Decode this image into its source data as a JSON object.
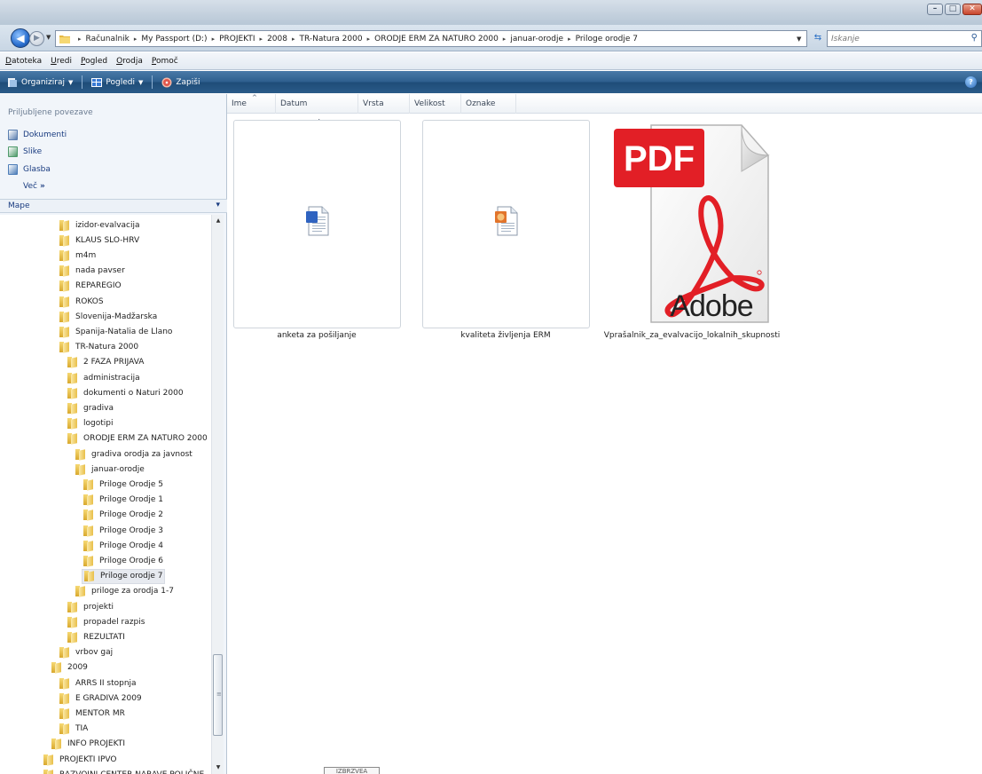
{
  "window": {
    "min_glyph": "–",
    "max_glyph": "□",
    "close_glyph": "✕"
  },
  "address": {
    "back_glyph": "◀",
    "fwd_glyph": "▶",
    "crumbs": [
      "Računalnik",
      "My Passport (D:)",
      "PROJEKTI",
      "2008",
      "TR-Natura 2000",
      "ORODJE ERM ZA NATURO 2000",
      "januar-orodje",
      "Priloge orodje 7"
    ],
    "separator": "▸",
    "search_placeholder": "Iskanje"
  },
  "menubar": [
    "Datoteka",
    "Uredi",
    "Pogled",
    "Orodja",
    "Pomoč"
  ],
  "commandbar": {
    "organize": "Organiziraj",
    "views": "Pogledi",
    "burn": "Zapiši",
    "help_glyph": "?"
  },
  "favorites": {
    "header": "Priljubljene povezave",
    "items": [
      {
        "label": "Dokumenti",
        "color": "#5b7fb0"
      },
      {
        "label": "Slike",
        "color": "#4f9a6b"
      },
      {
        "label": "Glasba",
        "color": "#4d7db8"
      }
    ],
    "more_label": "Več",
    "more_glyph": "»"
  },
  "folders_header": "Mape",
  "tree": [
    {
      "label": "izidor-evalvacija",
      "level": 3
    },
    {
      "label": "KLAUS SLO-HRV",
      "level": 3
    },
    {
      "label": "m4m",
      "level": 3
    },
    {
      "label": "nada pavser",
      "level": 3
    },
    {
      "label": "REPAREGIO",
      "level": 3
    },
    {
      "label": "ROKOS",
      "level": 3
    },
    {
      "label": "Slovenija-Madžarska",
      "level": 3
    },
    {
      "label": "Spanija-Natalia de Llano",
      "level": 3
    },
    {
      "label": "TR-Natura 2000",
      "level": 3
    },
    {
      "label": "2 FAZA PRIJAVA",
      "level": 4
    },
    {
      "label": "administracija",
      "level": 4
    },
    {
      "label": "dokumenti o Naturi 2000",
      "level": 4
    },
    {
      "label": "gradiva",
      "level": 4
    },
    {
      "label": "logotipi",
      "level": 4
    },
    {
      "label": "ORODJE ERM ZA NATURO 2000",
      "level": 4
    },
    {
      "label": "gradiva orodja za javnost",
      "level": 5
    },
    {
      "label": "januar-orodje",
      "level": 5
    },
    {
      "label": "Priloge  Orodje 5",
      "level": 6
    },
    {
      "label": "Priloge Orodje 1",
      "level": 6
    },
    {
      "label": "Priloge Orodje 2",
      "level": 6
    },
    {
      "label": "Priloge Orodje 3",
      "level": 6
    },
    {
      "label": "Priloge Orodje 4",
      "level": 6
    },
    {
      "label": "Priloge Orodje 6",
      "level": 6
    },
    {
      "label": "Priloge orodje 7",
      "level": 6,
      "selected": true
    },
    {
      "label": "priloge za orodja 1-7",
      "level": 5
    },
    {
      "label": "projekti",
      "level": 4
    },
    {
      "label": "propadel razpis",
      "level": 4
    },
    {
      "label": "REZULTATI",
      "level": 4
    },
    {
      "label": "vrbov gaj",
      "level": 3
    },
    {
      "label": "2009",
      "level": 2
    },
    {
      "label": "ARRS II stopnja",
      "level": 3
    },
    {
      "label": "E GRADIVA 2009",
      "level": 3
    },
    {
      "label": "MENTOR MR",
      "level": 3
    },
    {
      "label": "TIA",
      "level": 3
    },
    {
      "label": "INFO PROJEKTI",
      "level": 2
    },
    {
      "label": "PROJEKTI IPVO",
      "level": 1
    },
    {
      "label": "RAZVOJNI CENTER NARAVE POLIČNE",
      "level": 1
    }
  ],
  "columns": [
    "Ime",
    "Datum spremembe",
    "Vrsta",
    "Velikost",
    "Oznake"
  ],
  "files": [
    {
      "name": "anketa za pošiljanje",
      "kind": "word",
      "badge": "W"
    },
    {
      "name": "kvaliteta življenja ERM",
      "kind": "powerpoint",
      "badge": "P"
    },
    {
      "name": "Vprašalnik_za_evalvacijo_lokalnih_skupnosti",
      "kind": "pdf"
    }
  ],
  "pdf_icon": {
    "label": "PDF",
    "brand": "Adobe",
    "red": "#e21f26"
  },
  "tooltip": "IZBRZVEA",
  "colors": {
    "command_bar": "#2d5e8d",
    "link": "#1a3c80",
    "selection": "#e7eaf0"
  }
}
